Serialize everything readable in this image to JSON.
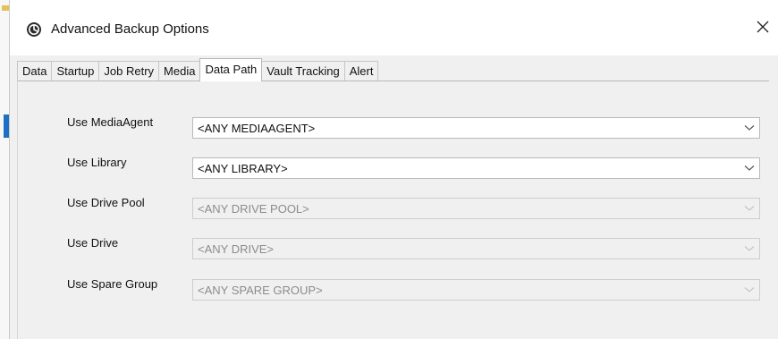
{
  "window": {
    "title": "Advanced Backup Options",
    "icon": "commvault-logo-icon",
    "close_icon": "close-icon"
  },
  "tabs": [
    {
      "label": "Data",
      "active": false
    },
    {
      "label": "Startup",
      "active": false
    },
    {
      "label": "Job Retry",
      "active": false
    },
    {
      "label": "Media",
      "active": false
    },
    {
      "label": "Data Path",
      "active": true
    },
    {
      "label": "Vault Tracking",
      "active": false
    },
    {
      "label": "Alert",
      "active": false
    }
  ],
  "data_path": {
    "fields": [
      {
        "label": "Use MediaAgent",
        "value": "<ANY MEDIAAGENT>",
        "enabled": true
      },
      {
        "label": "Use Library",
        "value": "<ANY LIBRARY>",
        "enabled": true
      },
      {
        "label": "Use Drive Pool",
        "value": "<ANY DRIVE POOL>",
        "enabled": false
      },
      {
        "label": "Use Drive",
        "value": "<ANY DRIVE>",
        "enabled": false
      },
      {
        "label": "Use Spare Group",
        "value": "<ANY SPARE GROUP>",
        "enabled": false
      }
    ]
  },
  "colors": {
    "accent_blue": "#1f6fc5",
    "disabled_text": "#8c8c8c"
  }
}
